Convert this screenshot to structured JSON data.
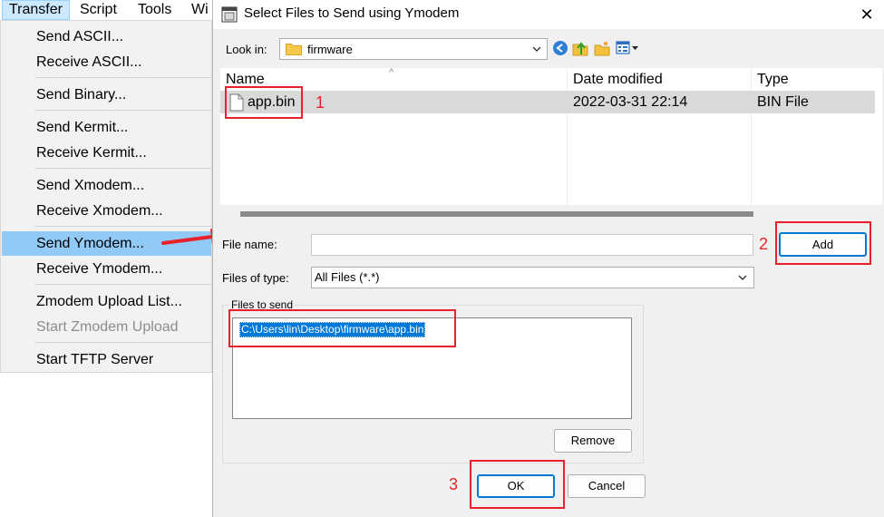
{
  "menubar": {
    "items": [
      "Transfer",
      "Script",
      "Tools",
      "Wi"
    ]
  },
  "menu": {
    "items": [
      {
        "label": "Send ASCII..."
      },
      {
        "label": "Receive ASCII..."
      },
      {
        "label": "Send Binary..."
      },
      {
        "label": "Send Kermit..."
      },
      {
        "label": "Receive Kermit..."
      },
      {
        "label": "Send Xmodem..."
      },
      {
        "label": "Receive Xmodem..."
      },
      {
        "label": "Send Ymodem..."
      },
      {
        "label": "Receive Ymodem..."
      },
      {
        "label": "Zmodem Upload List..."
      },
      {
        "label": "Start Zmodem Upload"
      },
      {
        "label": "Start TFTP Server"
      }
    ]
  },
  "dialog": {
    "title": "Select Files to Send using Ymodem",
    "close_label": "✕",
    "lookin_label": "Look in:",
    "lookin_value": "firmware",
    "columns": [
      "Name",
      "Date modified",
      "Type"
    ],
    "files": [
      {
        "name": "app.bin",
        "date": "2022-03-31 22:14",
        "type": "BIN File"
      }
    ],
    "filename_label": "File name:",
    "filename_value": "",
    "filetype_label": "Files of type:",
    "filetype_value": "All Files (*.*)",
    "files_to_send_label": "Files to send",
    "files_to_send": [
      "C:\\Users\\lin\\Desktop\\firmware\\app.bin"
    ],
    "add_label": "Add",
    "remove_label": "Remove",
    "ok_label": "OK",
    "cancel_label": "Cancel"
  },
  "annotations": {
    "step1": "1",
    "step2": "2",
    "step3": "3",
    "color": "#e8222a"
  },
  "colors": {
    "menu_highlight": "#91c9f7",
    "selection": "#0078d7",
    "default_button_border": "#0078d4"
  },
  "icons": [
    "folder-icon",
    "back-icon",
    "up-folder-icon",
    "new-folder-icon",
    "view-menu-icon",
    "file-icon",
    "close-icon",
    "dropdown-arrow-icon",
    "red-arrow"
  ]
}
